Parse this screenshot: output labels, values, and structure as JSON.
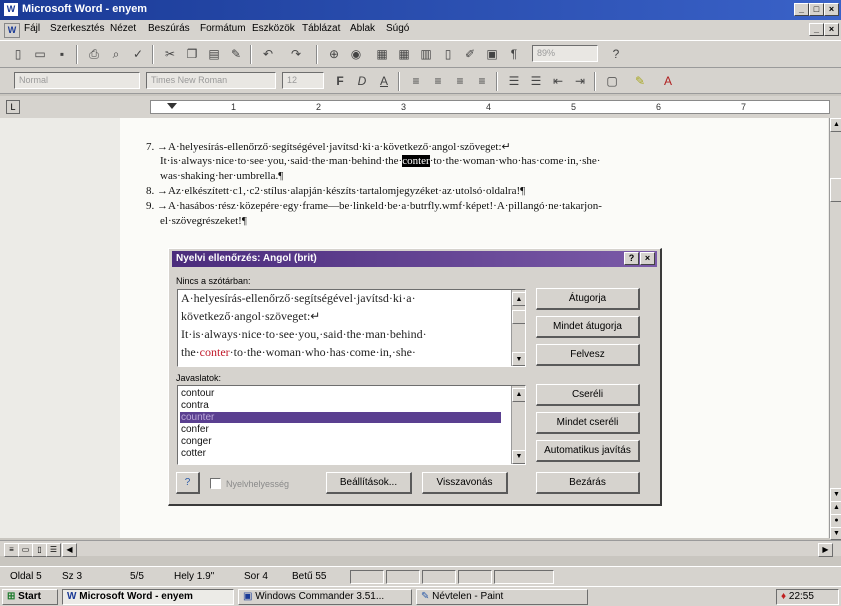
{
  "window": {
    "title": "Microsoft Word - enyem",
    "controls": [
      "_",
      "□",
      "×"
    ]
  },
  "menu": {
    "items": [
      "Fájl",
      "Szerkesztés",
      "Nézet",
      "Beszúrás",
      "Formátum",
      "Eszközök",
      "Táblázat",
      "Ablak",
      "Súgó"
    ]
  },
  "toolbar": {
    "zoom": "89%",
    "style": "Normal",
    "font": "Times New Roman",
    "size": "12"
  },
  "ruler": {
    "ticks": [
      "1",
      "2",
      "3",
      "4",
      "5",
      "6",
      "7"
    ]
  },
  "document": {
    "lines": [
      "7. →A·helyesírás-ellenőrző·segítségével·javítsd·ki·a·következő·angol·szöveget:↵",
      "It·is·always·nice·to·see·you,·said·the·man·behind·the·conter·to·the·woman·who·has·come·in,·she·",
      "was·shaking·her·umbrella.¶",
      "8. →Az·elkészített·c1,·c2·stílus·alapján·készíts·tartalomjegyzéket·az·utolsó·oldalra!¶",
      "9. →A·hasábos·rész·közepére·egy·frame—be·linkeld·be·a·butrfly.wmf·képet!·A·pillangó·ne·takarjon-",
      "el·szövegrészeket!¶"
    ]
  },
  "dialog": {
    "title": "Nyelvi ellenőrzés: Angol (brit)",
    "help_button": "?",
    "close_button": "×",
    "notfound_label": "Nincs a szótárban:",
    "notfound_lines": [
      "A·helyesírás-ellenőrző·segítségével·javítsd·ki·a·",
      "következő·angol·szöveget:↵",
      "It·is·always·nice·to·see·you,·said·the·man·behind·",
      "the·",
      "conter",
      "·to·the·woman·who·has·come·in,·she·"
    ],
    "suggestions_label": "Javaslatok:",
    "suggestions": [
      "contour",
      "contra",
      "counter",
      "confer",
      "conger",
      "cotter"
    ],
    "selected_suggestion": 2,
    "buttons": {
      "ignore": "Átugorja",
      "ignore_all": "Mindet átugorja",
      "add": "Felvesz",
      "change": "Cseréli",
      "change_all": "Mindet cseréli",
      "autocorrect": "Automatikus javítás",
      "options": "Beállítások...",
      "undo": "Visszavonás",
      "close": "Bezárás"
    },
    "grammar_checkbox": "Nyelvhelyesség"
  },
  "status": {
    "page": "Oldal 5",
    "section": "Sz 3",
    "pages": "5/5",
    "position": "Hely 1.9\"",
    "line": "Sor 4",
    "column": "Betű 55"
  },
  "taskbar": {
    "start": "Start",
    "tasks": [
      "Microsoft Word - enyem",
      "Windows Commander 3.51...",
      "Névtelen - Paint"
    ],
    "clock": "22:55"
  },
  "colors": {
    "titlebar": "#1a3a96",
    "dialog_title": "#5a3f90",
    "error": "#c0192a",
    "selection": "#5a3f90"
  }
}
